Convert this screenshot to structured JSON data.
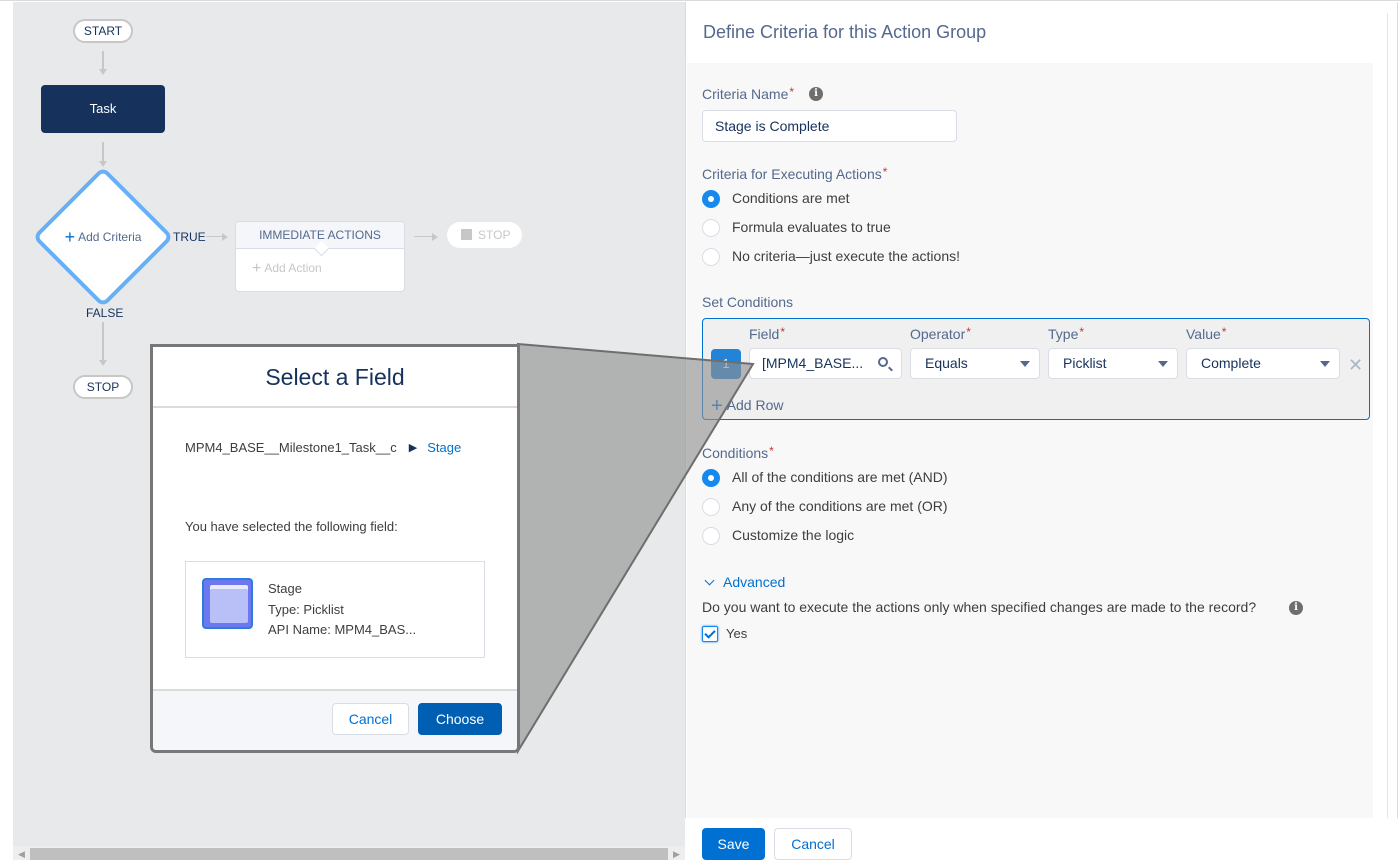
{
  "flow": {
    "start_label": "START",
    "task_label": "Task",
    "criteria_node_label": "Add Criteria",
    "true_label": "TRUE",
    "false_label": "FALSE",
    "immediate_actions_label": "IMMEDIATE ACTIONS",
    "add_action_label": "Add Action",
    "stop_true_label": "STOP",
    "stop_false_label": "STOP"
  },
  "modal": {
    "title": "Select a Field",
    "breadcrumb_object": "MPM4_BASE__Milestone1_Task__c",
    "breadcrumb_field": "Stage",
    "selected_text": "You have selected the following field:",
    "field_name": "Stage",
    "field_type": "Type: Picklist",
    "field_api_name": "API Name: MPM4_BAS...",
    "cancel_label": "Cancel",
    "choose_label": "Choose"
  },
  "panel": {
    "title": "Define Criteria for this Action Group",
    "criteria_name_label": "Criteria Name",
    "criteria_name_value": "Stage is Complete",
    "executing_label": "Criteria for Executing Actions",
    "executing_options": [
      {
        "label": "Conditions are met",
        "selected": true
      },
      {
        "label": "Formula evaluates to true",
        "selected": false
      },
      {
        "label": "No criteria—just execute the actions!",
        "selected": false
      }
    ],
    "set_conditions_label": "Set Conditions",
    "columns": {
      "field": "Field",
      "operator": "Operator",
      "type": "Type",
      "value": "Value"
    },
    "rows": [
      {
        "number": "1",
        "field": "[MPM4_BASE...",
        "operator": "Equals",
        "type": "Picklist",
        "value": "Complete"
      }
    ],
    "add_row_label": "Add Row",
    "conditions_label": "Conditions",
    "conditions_options": [
      {
        "label": "All of the conditions are met (AND)",
        "selected": true
      },
      {
        "label": "Any of the conditions are met (OR)",
        "selected": false
      },
      {
        "label": "Customize the logic",
        "selected": false
      }
    ],
    "advanced_label": "Advanced",
    "advanced_question": "Do you want to execute the actions only when specified changes are made to the record?",
    "yes_label": "Yes",
    "yes_checked": true,
    "save_label": "Save",
    "cancel_label": "Cancel"
  },
  "colors": {
    "brand": "#0070d2",
    "navy": "#16325c",
    "diamond_border": "#68b0f5",
    "required": "#c23934"
  }
}
